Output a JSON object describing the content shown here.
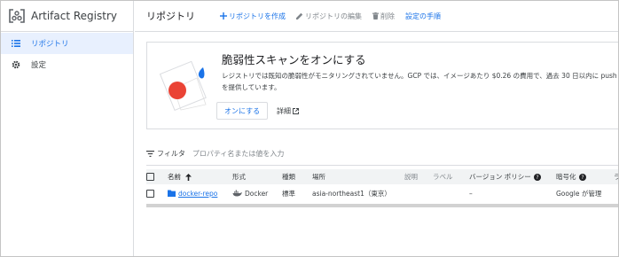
{
  "app": {
    "title": "Artifact Registry"
  },
  "sidebar": {
    "items": [
      {
        "label": "リポジトリ",
        "icon": "list-icon",
        "active": true
      },
      {
        "label": "設定",
        "icon": "gear-icon",
        "active": false
      }
    ]
  },
  "topbar": {
    "title": "リポジトリ",
    "create_label": "リポジトリを作成",
    "edit_label": "リポジトリの編集",
    "delete_label": "削除",
    "setup_label": "設定の手順"
  },
  "banner": {
    "title": "脆弱性スキャンをオンにする",
    "body_line1": "レジストリでは既知の脆弱性がモニタリングされていません。GCP では、イメージあたり $0.26 の費用で、過去 30 日以内に push",
    "body_line2": "を提供しています。",
    "enable_button": "オンにする",
    "details_link": "詳細"
  },
  "filter": {
    "label": "フィルタ",
    "placeholder": "プロパティ名または値を入力"
  },
  "table": {
    "headers": {
      "name": "名前",
      "format": "形式",
      "type": "種類",
      "location": "場所",
      "description": "説明",
      "labels": "ラベル",
      "version_policy": "バージョン ポリシー",
      "encryption": "暗号化",
      "cut": "ラ"
    },
    "rows": [
      {
        "name": "docker-repo",
        "format": "Docker",
        "type": "標準",
        "location": "asia-northeast1（東京）",
        "description": "",
        "labels": "",
        "version_policy": "–",
        "encryption": "Google が管理"
      }
    ]
  },
  "colors": {
    "accent": "#1a73e8",
    "danger": "#ea4335",
    "border": "#dadce0"
  }
}
